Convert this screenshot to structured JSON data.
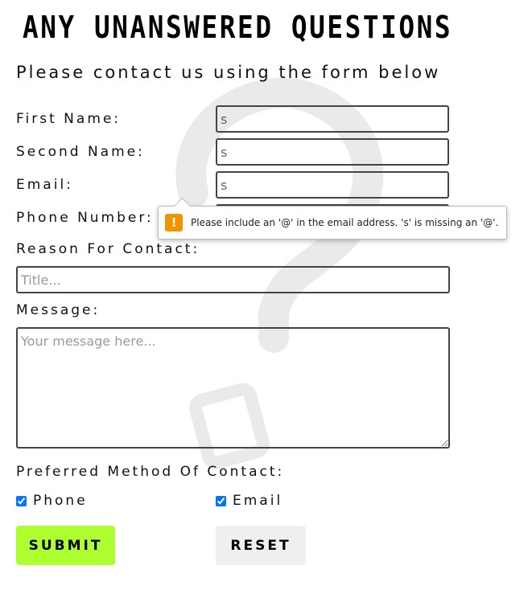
{
  "header": {
    "title": "ANY UNANSWERED QUESTIONS",
    "subtitle": "Please contact us using the form below"
  },
  "form": {
    "first_name": {
      "label": "First Name:",
      "value": "s"
    },
    "second_name": {
      "label": "Second Name:",
      "value": "s"
    },
    "email": {
      "label": "Email:",
      "value": "s"
    },
    "phone": {
      "label": "Phone Number:",
      "value": ""
    },
    "reason": {
      "label": "Reason For Contact:",
      "placeholder": "Title..."
    },
    "message": {
      "label": "Message:",
      "placeholder": "Your message here..."
    },
    "preferred": {
      "label": "Preferred Method Of Contact:",
      "options": [
        {
          "label": "Phone",
          "checked": true
        },
        {
          "label": "Email",
          "checked": true
        }
      ]
    },
    "submit_label": "SUBMIT",
    "reset_label": "RESET"
  },
  "validation_tooltip": {
    "icon": "warning-icon",
    "icon_glyph": "!",
    "text": "Please include an '@' in the email address. 's' is missing an '@'."
  },
  "colors": {
    "submit_bg": "#adff2f",
    "reset_bg": "#efefef",
    "warning": "#f29300",
    "checkbox": "#0075ff"
  }
}
